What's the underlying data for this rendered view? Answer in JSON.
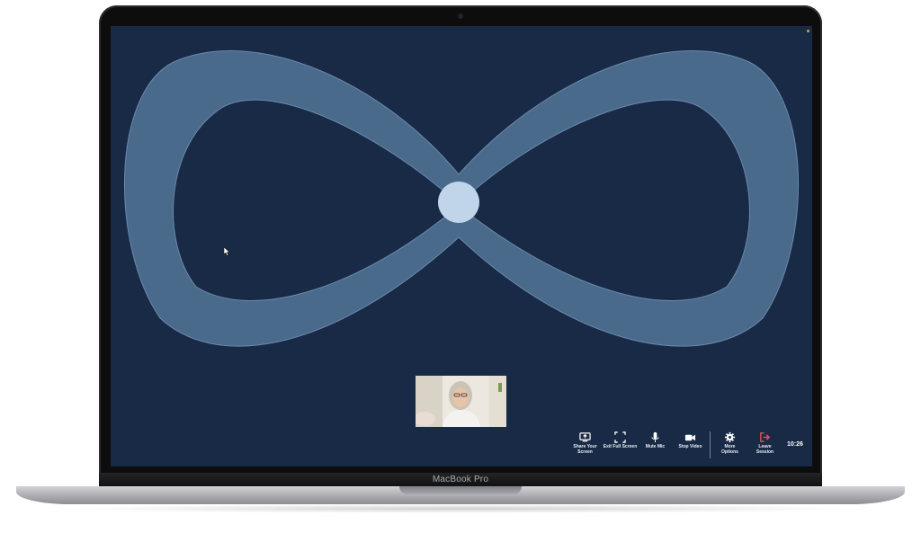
{
  "device": {
    "brand_label": "MacBook Pro"
  },
  "session": {
    "clock": "10:26",
    "participant_tile": {
      "label": ""
    }
  },
  "toolbar": {
    "share_screen_label": "Share Your\nScreen",
    "exit_fullscreen_label": "Exit Full Screen",
    "mute_mic_label": "Mute Mic",
    "stop_video_label": "Stop Video",
    "more_options_label": "More\nOptions",
    "leave_session_label": "Leave\nSession"
  },
  "colors": {
    "background": "#182a45",
    "infinity_band": "#4a6a8c",
    "center_dot": "#c0d4ea",
    "leave_accent": "#e4505a",
    "toolbar_text": "#e8eef7"
  },
  "icons": {
    "share": "monitor-icon",
    "fullscreen": "exit-fullscreen-icon",
    "mic": "microphone-icon",
    "video": "video-camera-icon",
    "more": "gear-icon",
    "leave": "leave-icon"
  }
}
